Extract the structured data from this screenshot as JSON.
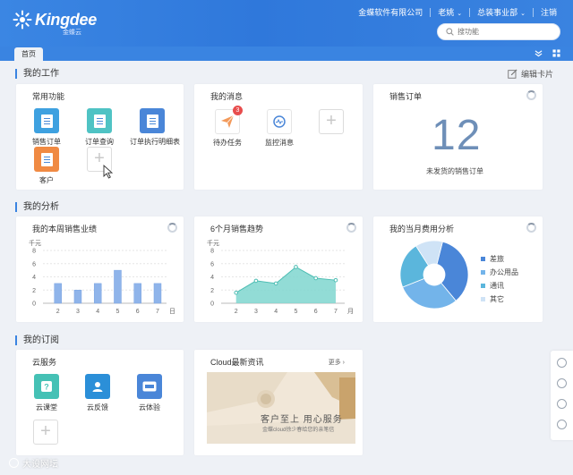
{
  "header": {
    "logo_text": "Kingdee",
    "logo_sub": "金蝶云",
    "company": "金蝶软件有限公司",
    "user": "老姚",
    "department": "总装事业部",
    "logout": "注销",
    "search_placeholder": "搜功能"
  },
  "tabs": {
    "home": "首页"
  },
  "sections": {
    "work": "我的工作",
    "edit_card": "编辑卡片",
    "analysis": "我的分析",
    "subscriptions": "我的订阅"
  },
  "common_functions": {
    "title": "常用功能",
    "items": [
      {
        "label": "销售订单",
        "color": "#3ea1e0"
      },
      {
        "label": "订单查询",
        "color": "#4fc3c4"
      },
      {
        "label": "订单执行明细表",
        "color": "#4a86d8"
      },
      {
        "label": "客户",
        "color": "#f08a43"
      }
    ]
  },
  "messages": {
    "title": "我的消息",
    "items": [
      {
        "label": "待办任务",
        "badge": "3"
      },
      {
        "label": "监控消息"
      }
    ]
  },
  "sales_order": {
    "title": "销售订单",
    "count": "12",
    "caption": "未发货的销售订单"
  },
  "weekly_sales": {
    "title": "我的本周销售业绩",
    "unit": "千元",
    "x_suffix": "日",
    "chart_data": {
      "type": "bar",
      "categories": [
        "2",
        "3",
        "4",
        "5",
        "6",
        "7"
      ],
      "values": [
        3,
        2,
        3,
        5,
        3,
        3
      ],
      "ylim": [
        0,
        8
      ],
      "yticks": [
        0,
        2,
        4,
        6,
        8
      ],
      "ylabel": "千元",
      "xlabel": "日"
    }
  },
  "six_month_trend": {
    "title": "6个月销售趋势",
    "unit": "千元",
    "x_suffix": "月",
    "chart_data": {
      "type": "area",
      "categories": [
        "2",
        "3",
        "4",
        "5",
        "6",
        "7"
      ],
      "values": [
        1.6,
        3.4,
        3.0,
        5.5,
        3.8,
        3.5
      ],
      "ylim": [
        0,
        8
      ],
      "yticks": [
        0,
        2,
        4,
        6,
        8
      ],
      "ylabel": "千元",
      "xlabel": "月"
    }
  },
  "expense_analysis": {
    "title": "我的当月费用分析",
    "chart_data": {
      "type": "pie",
      "categories": [
        "差旅",
        "办公用品",
        "通讯",
        "其它"
      ],
      "values": [
        35,
        30,
        22,
        13
      ],
      "colors": [
        "#4a86d8",
        "#73b4ea",
        "#5bb6dc",
        "#cfe3f6"
      ]
    }
  },
  "cloud_services": {
    "title": "云服务",
    "items": [
      {
        "label": "云课堂",
        "color": "#45c1b5"
      },
      {
        "label": "云反馈",
        "color": "#2b8fd8"
      },
      {
        "label": "云体验",
        "color": "#4a86d8"
      }
    ]
  },
  "cloud_news": {
    "title": "Cloud最新资讯",
    "more": "更多",
    "headline": "客户至上 用心服务",
    "subline": "金蝶cloud徐少春给您的亲笔信"
  },
  "watermark": "大设网坛"
}
